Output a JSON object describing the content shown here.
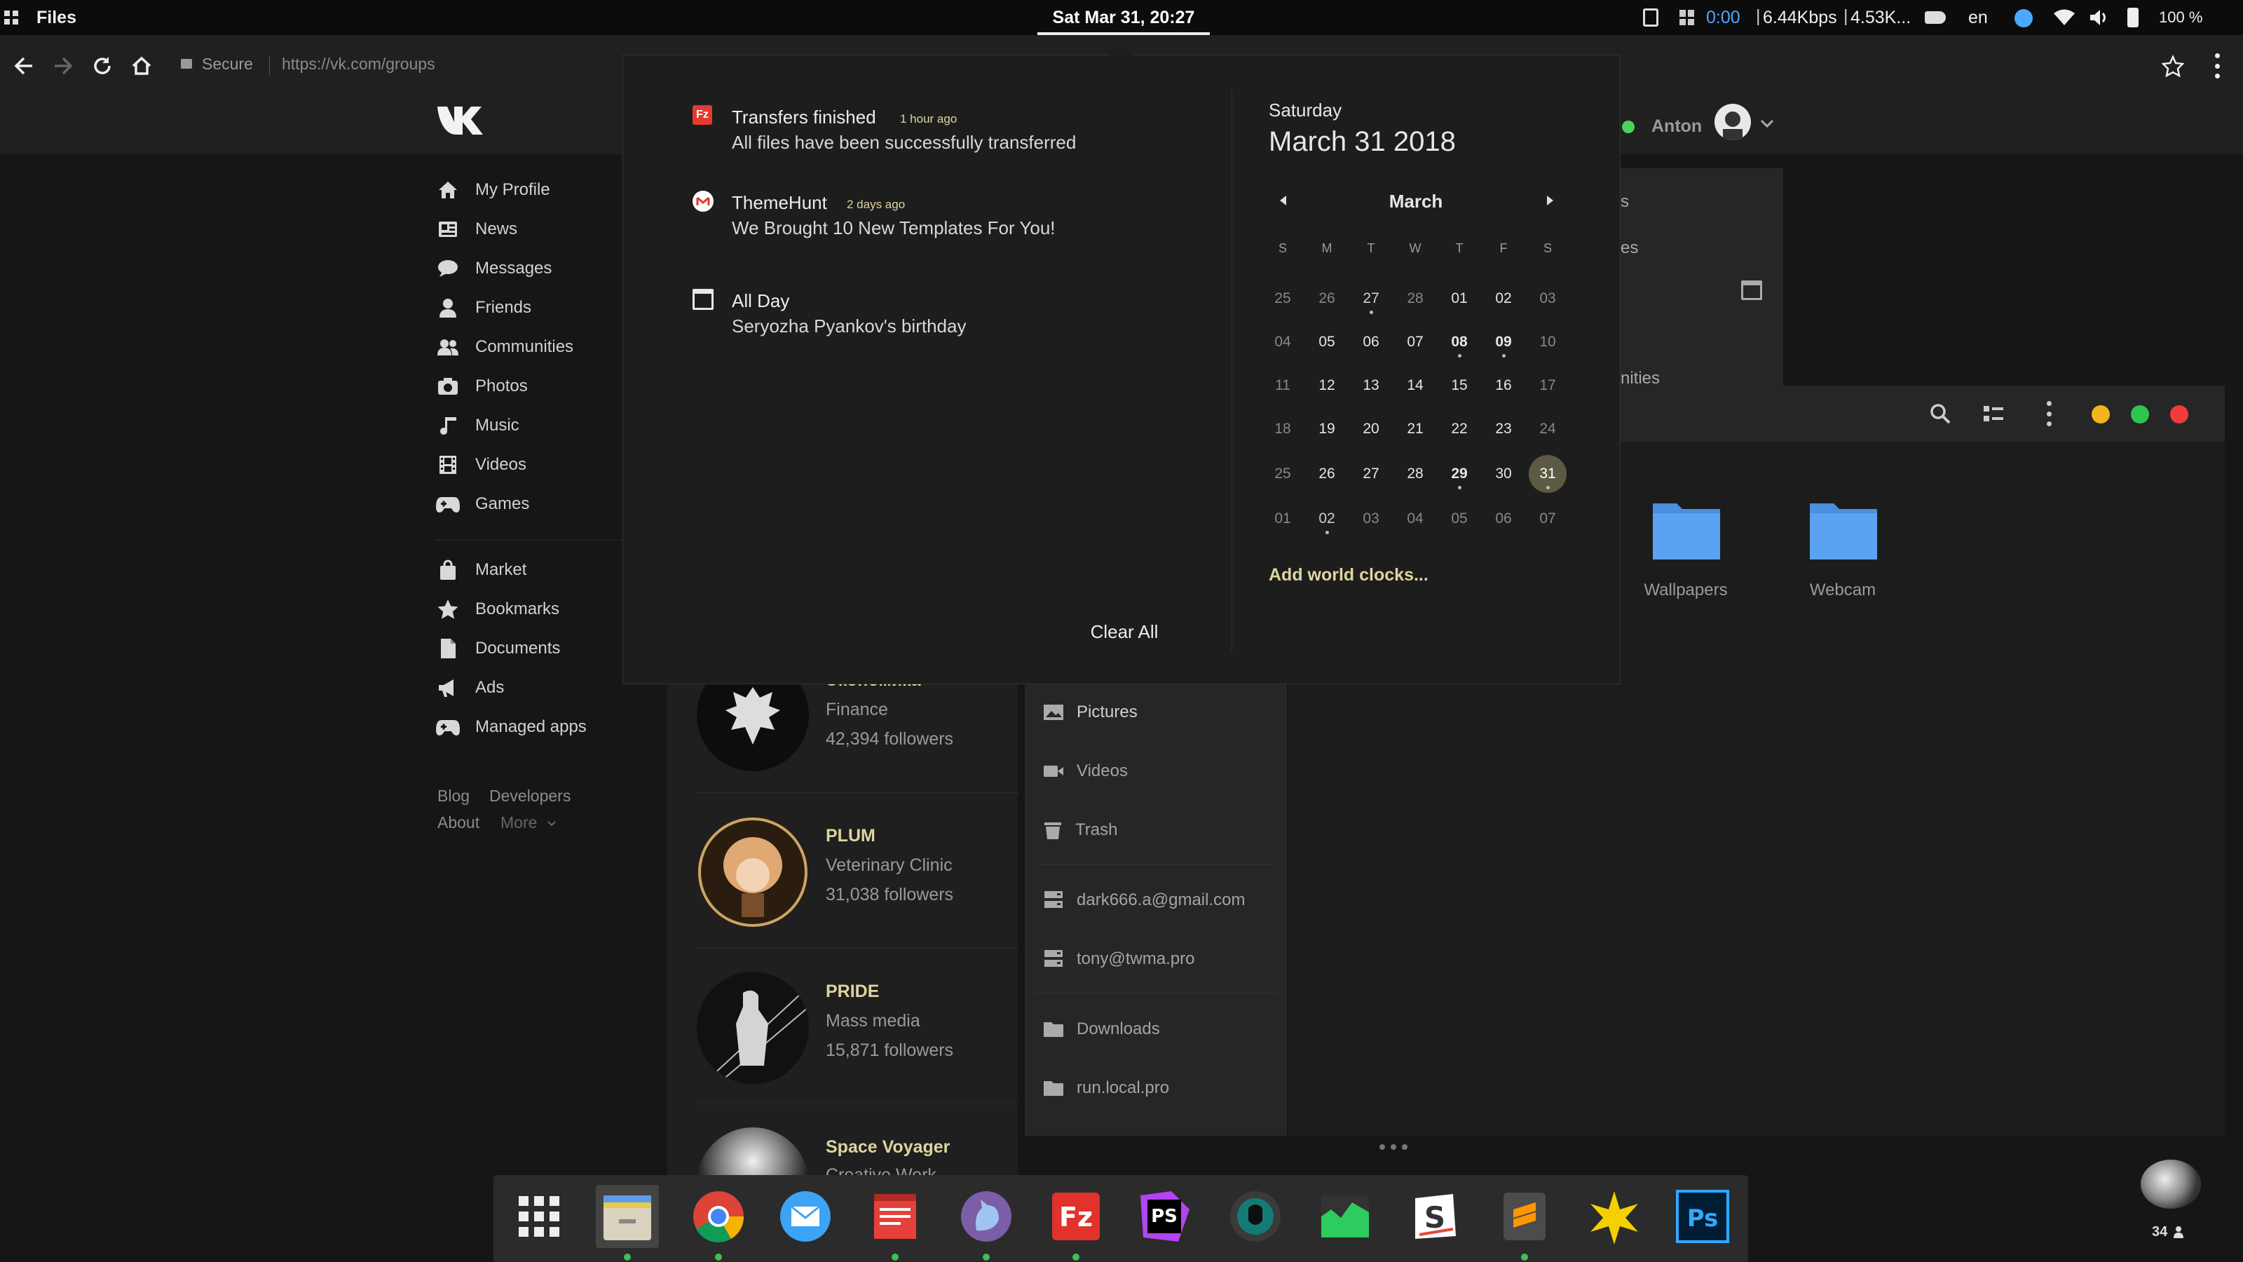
{
  "topbar": {
    "app_name": "Files",
    "clock": "Sat Mar 31, 20:27",
    "timer": "0:00",
    "network": "6.44Kbps",
    "network2": "4.53K...",
    "lang": "en",
    "battery": "100 %"
  },
  "browser": {
    "secure_label": "Secure",
    "url": "https://vk.com/groups"
  },
  "vk": {
    "user_name": "Anton",
    "nav": [
      {
        "label": "My Profile",
        "icon": "home-icon"
      },
      {
        "label": "News",
        "icon": "news-icon"
      },
      {
        "label": "Messages",
        "icon": "messages-icon"
      },
      {
        "label": "Friends",
        "icon": "friends-icon"
      },
      {
        "label": "Communities",
        "icon": "communities-icon"
      },
      {
        "label": "Photos",
        "icon": "camera-icon"
      },
      {
        "label": "Music",
        "icon": "music-icon"
      },
      {
        "label": "Videos",
        "icon": "film-icon"
      },
      {
        "label": "Games",
        "icon": "gamepad-icon"
      }
    ],
    "nav2": [
      {
        "label": "Market",
        "icon": "bag-icon"
      },
      {
        "label": "Bookmarks",
        "icon": "star-icon"
      },
      {
        "label": "Documents",
        "icon": "document-icon"
      },
      {
        "label": "Ads",
        "icon": "megaphone-icon"
      },
      {
        "label": "Managed apps",
        "icon": "gamepad-icon"
      }
    ],
    "footer": {
      "blog": "Blog",
      "developers": "Developers",
      "about": "About",
      "more": "More"
    },
    "communities": [
      {
        "name": "Экономика+",
        "category": "Finance",
        "followers": "42,394 followers"
      },
      {
        "name": "PLUM",
        "category": "Veterinary Clinic",
        "followers": "31,038 followers"
      },
      {
        "name": "PRIDE",
        "category": "Mass media",
        "followers": "15,871 followers"
      },
      {
        "name": "Space Voyager",
        "category": "Creative Work",
        "followers": ""
      }
    ],
    "right_panel_text1": "s",
    "right_panel_text2": "es",
    "right_panel_text3": "nities"
  },
  "files": {
    "sidebar": [
      {
        "label": "Pictures",
        "icon": "image-icon"
      },
      {
        "label": "Videos",
        "icon": "video-icon"
      },
      {
        "label": "Trash",
        "icon": "trash-icon"
      },
      {
        "label": "dark666.a@gmail.com",
        "icon": "network-drive-icon"
      },
      {
        "label": "tony@twma.pro",
        "icon": "network-drive-icon"
      },
      {
        "label": "Downloads",
        "icon": "folder-icon"
      },
      {
        "label": "run.local.pro",
        "icon": "folder-icon"
      }
    ],
    "folders": [
      {
        "label": "Wallpapers"
      },
      {
        "label": "Webcam"
      }
    ],
    "window_buttons": {
      "minimize": "#f2b51e",
      "maximize": "#2ec650",
      "close": "#f23b3b"
    }
  },
  "notifications": [
    {
      "title": "Transfers finished",
      "time": "1 hour ago",
      "body": "All files have been successfully transferred",
      "icon": "filezilla-icon"
    },
    {
      "title": "ThemeHunt",
      "time": "2 days ago",
      "body": "We Brought 10 New Templates For You!",
      "icon": "gmail-icon"
    },
    {
      "title": "All Day",
      "time": "",
      "body": "Seryozha Pyankov's birthday",
      "icon": "calendar-icon"
    }
  ],
  "clear_all": "Clear All",
  "calendar": {
    "weekday": "Saturday",
    "date": "March 31 2018",
    "month": "March",
    "day_headers": [
      "S",
      "M",
      "T",
      "W",
      "T",
      "F",
      "S"
    ],
    "weeks": [
      [
        "25",
        "26",
        "27",
        "28",
        "01",
        "02",
        "03"
      ],
      [
        "04",
        "05",
        "06",
        "07",
        "08",
        "09",
        "10"
      ],
      [
        "11",
        "12",
        "13",
        "14",
        "15",
        "16",
        "17"
      ],
      [
        "18",
        "19",
        "20",
        "21",
        "22",
        "23",
        "24"
      ],
      [
        "25",
        "26",
        "27",
        "28",
        "29",
        "30",
        "31"
      ],
      [
        "01",
        "02",
        "03",
        "04",
        "05",
        "06",
        "07"
      ]
    ],
    "add_clocks": "Add world clocks..."
  },
  "dock": {
    "user_count": "34",
    "apps": [
      "app-grid-icon",
      "files-icon",
      "chrome-icon",
      "mail-icon",
      "text-editor-icon",
      "gnome-icon",
      "filezilla-icon",
      "phpstorm-icon",
      "gitkraken-icon",
      "system-monitor-icon",
      "slack-icon",
      "sublime-icon",
      "kde-icon",
      "photoshop-icon"
    ]
  },
  "colors": {
    "accent": "#ddd59e",
    "today": "#5d5a44"
  }
}
